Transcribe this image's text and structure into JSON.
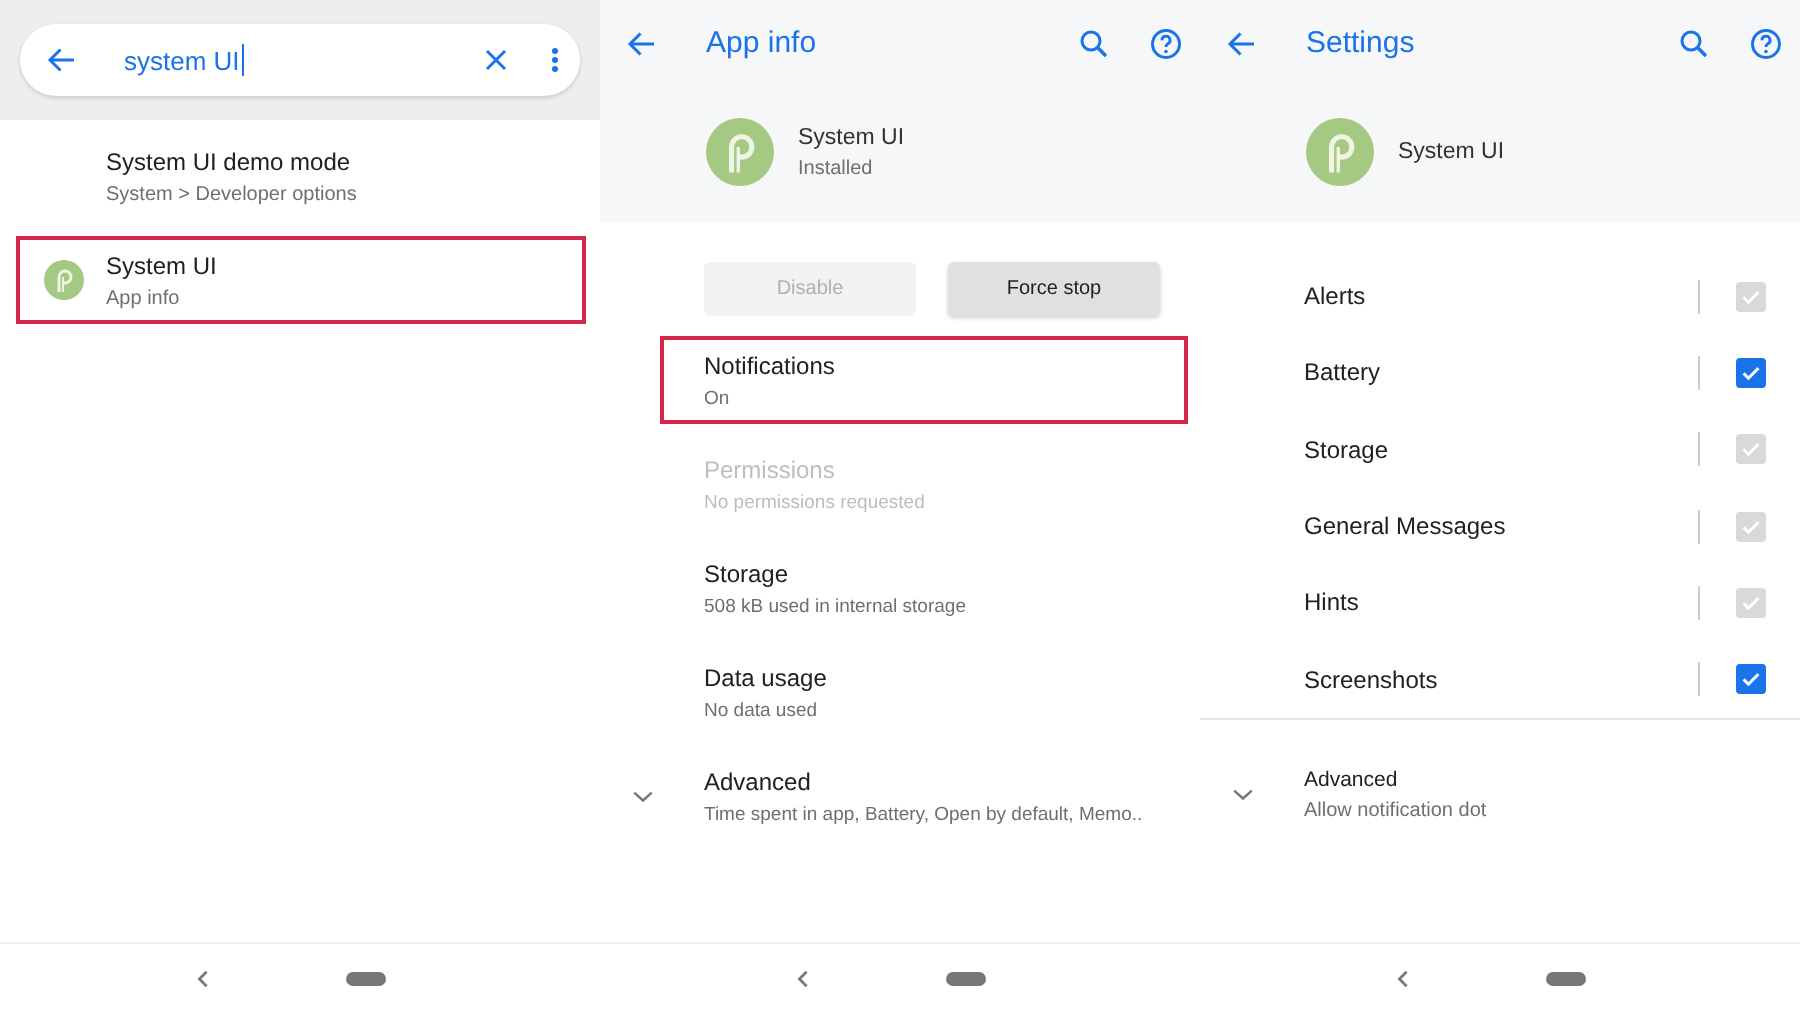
{
  "panels": [
    {
      "kind": "search",
      "search": {
        "value": "system UI"
      },
      "results": [
        {
          "title": "System UI demo mode",
          "subtitle": "System > Developer options",
          "has_icon": false,
          "highlighted": false
        },
        {
          "title": "System UI",
          "subtitle": "App info",
          "has_icon": true,
          "highlighted": true
        }
      ]
    },
    {
      "kind": "app_info",
      "title": "App info",
      "app": {
        "name": "System UI",
        "status": "Installed"
      },
      "buttons": [
        {
          "label": "Disable",
          "disabled": true
        },
        {
          "label": "Force stop",
          "disabled": false
        }
      ],
      "items": [
        {
          "title": "Notifications",
          "subtitle": "On",
          "disabled": false,
          "highlighted": true,
          "expandable": false
        },
        {
          "title": "Permissions",
          "subtitle": "No permissions requested",
          "disabled": true,
          "highlighted": false,
          "expandable": false
        },
        {
          "title": "Storage",
          "subtitle": "508 kB used in internal storage",
          "disabled": false,
          "highlighted": false,
          "expandable": false
        },
        {
          "title": "Data usage",
          "subtitle": "No data used",
          "disabled": false,
          "highlighted": false,
          "expandable": false
        },
        {
          "title": "Advanced",
          "subtitle": "Time spent in app, Battery, Open by default, Memo..",
          "disabled": false,
          "highlighted": false,
          "expandable": true
        }
      ]
    },
    {
      "kind": "settings",
      "title": "Settings",
      "app": {
        "name": "System UI"
      },
      "toggles": [
        {
          "label": "Alerts",
          "checked": true,
          "disabled": true
        },
        {
          "label": "Battery",
          "checked": true,
          "disabled": false
        },
        {
          "label": "Storage",
          "checked": true,
          "disabled": true
        },
        {
          "label": "General Messages",
          "checked": true,
          "disabled": true
        },
        {
          "label": "Hints",
          "checked": true,
          "disabled": true
        },
        {
          "label": "Screenshots",
          "checked": true,
          "disabled": false
        }
      ],
      "advanced": {
        "title": "Advanced",
        "subtitle": "Allow notification dot"
      }
    }
  ]
}
